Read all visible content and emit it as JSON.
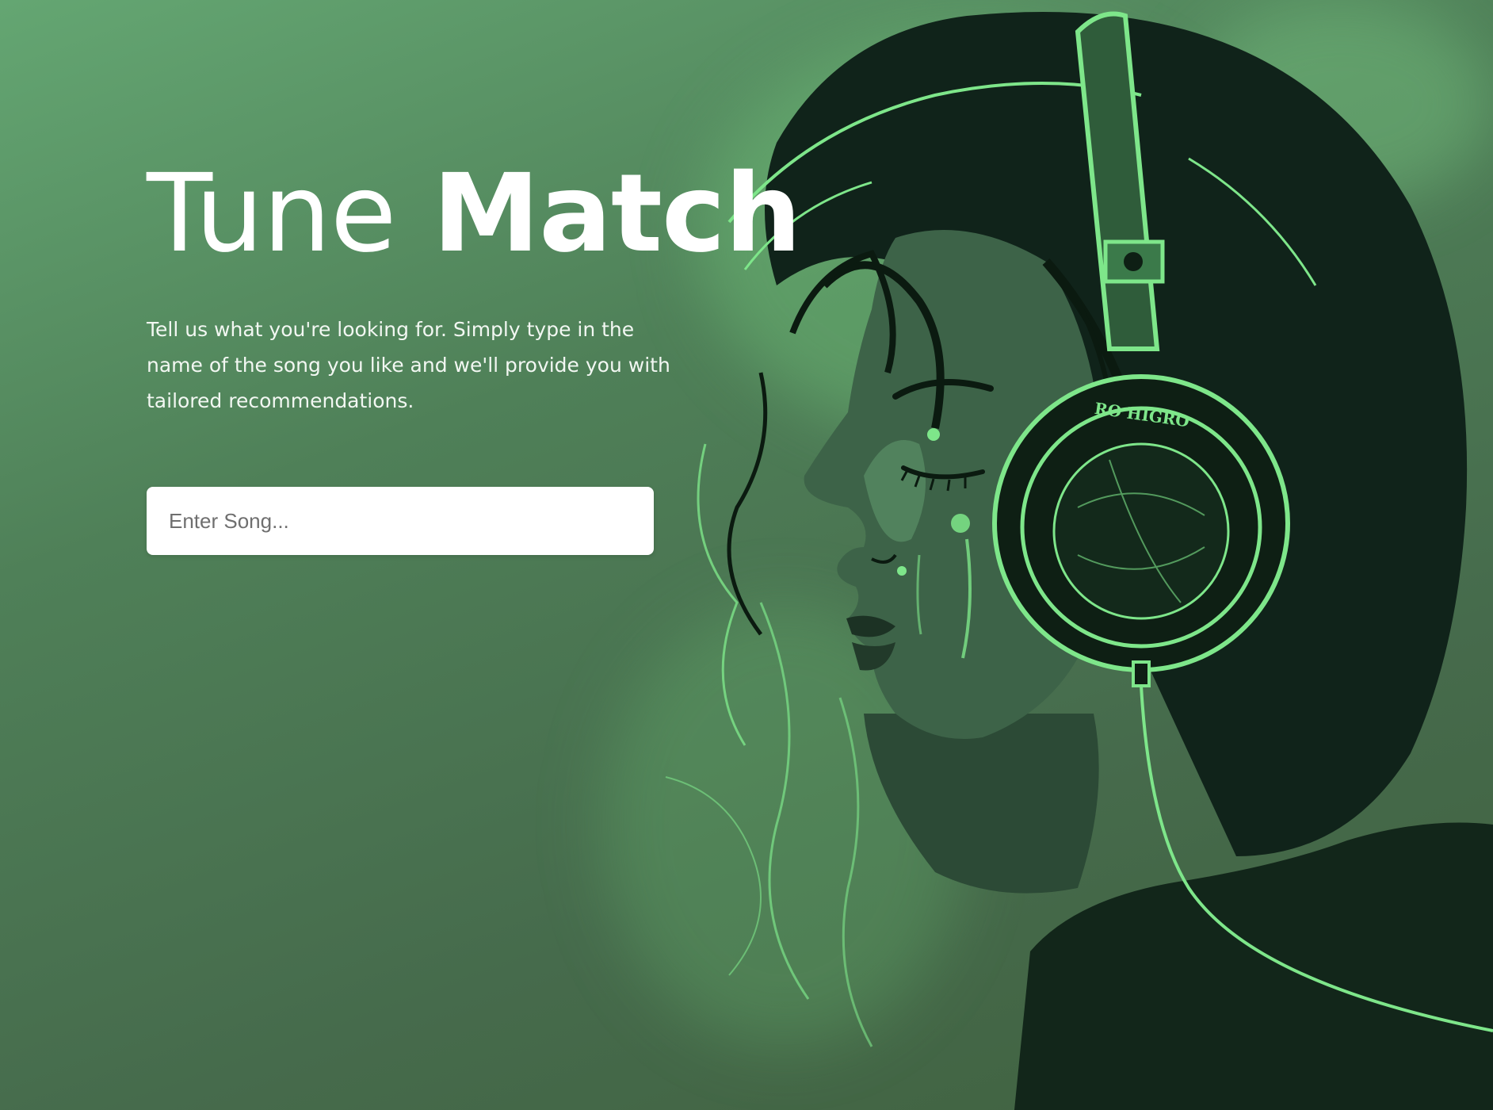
{
  "hero": {
    "title_word_1": "Tune",
    "title_word_2": "Match",
    "description": "Tell us what you're looking for. Simply type in the name of the song you like and we'll provide you with tailored recommendations."
  },
  "search": {
    "placeholder": "Enter Song...",
    "value": ""
  },
  "illustration": {
    "headphone_text": "RO HIGRO"
  },
  "colors": {
    "background_top": "#64a672",
    "background_bottom": "#40613f",
    "neon_accent": "#7ee68a",
    "dark_ink": "#0e1f14"
  }
}
